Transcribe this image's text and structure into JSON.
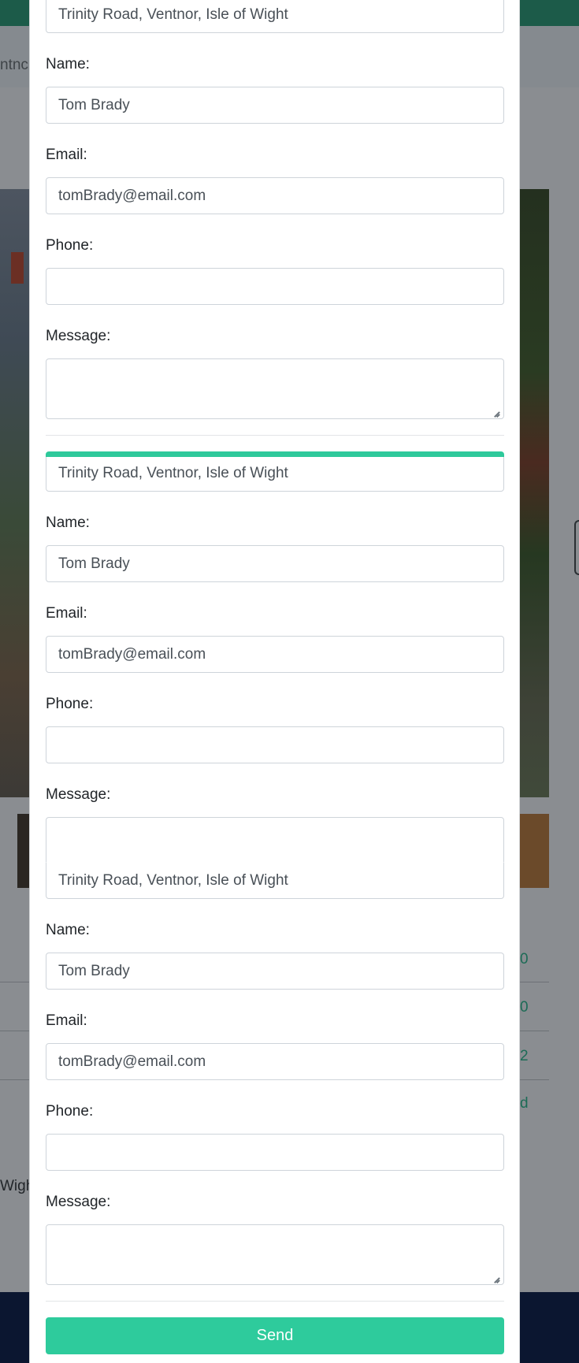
{
  "background": {
    "breadcrumb_fragment": "ntnc",
    "row_values": [
      "0",
      "0",
      "2",
      "d"
    ],
    "location_fragment": "Wigh"
  },
  "forms": [
    {
      "address": "Trinity Road, Ventnor, Isle of Wight",
      "name_label": "Name:",
      "name_value": "Tom Brady",
      "email_label": "Email:",
      "email_value": "tomBrady@email.com",
      "phone_label": "Phone:",
      "phone_value": "",
      "message_label": "Message:",
      "message_value": ""
    },
    {
      "address": "Trinity Road, Ventnor, Isle of Wight",
      "name_label": "Name:",
      "name_value": "Tom Brady",
      "email_label": "Email:",
      "email_value": "tomBrady@email.com",
      "phone_label": "Phone:",
      "phone_value": "",
      "message_label": "Message:",
      "message_value": ""
    },
    {
      "address": "Trinity Road, Ventnor, Isle of Wight",
      "name_label": "Name:",
      "name_value": "Tom Brady",
      "email_label": "Email:",
      "email_value": "tomBrady@email.com",
      "phone_label": "Phone:",
      "phone_value": "",
      "message_label": "Message:",
      "message_value": ""
    }
  ],
  "send_label": "Send",
  "colors": {
    "accent": "#2ecb9c",
    "topbar": "#1c5b49",
    "footer": "#0b1630"
  }
}
